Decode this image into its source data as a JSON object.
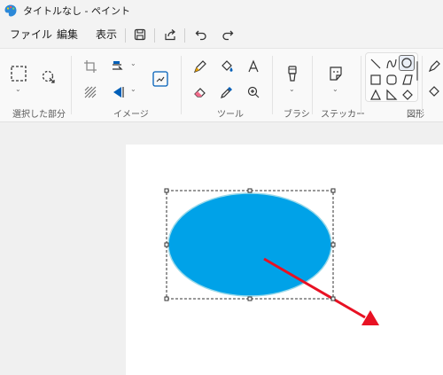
{
  "window": {
    "title": "タイトルなし - ペイント",
    "app_icon": "paint-palette-icon"
  },
  "menu": {
    "file": "ファイル",
    "edit": "編集",
    "view": "表示",
    "icons": [
      "save-icon",
      "share-icon",
      "undo-icon",
      "redo-icon"
    ]
  },
  "ribbon": {
    "groups": {
      "selection": "選択した部分",
      "image": "イメージ",
      "tools": "ツール",
      "brushes": "ブラシ",
      "stickers": "ステッカー",
      "shapes": "図形"
    },
    "selected_shape": "oval"
  },
  "canvas": {
    "fill_color": "#00a2e8",
    "arrow_color": "#e81123",
    "background": "#ffffff"
  }
}
